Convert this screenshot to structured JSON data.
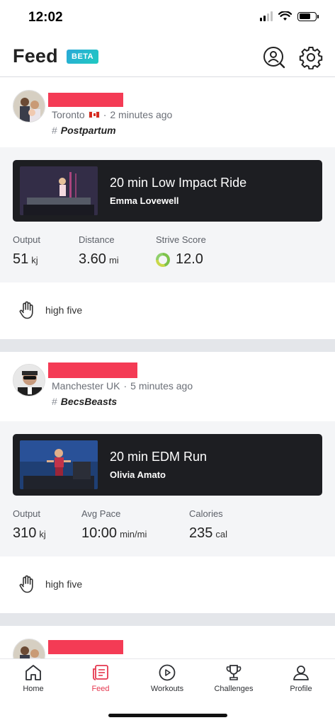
{
  "status_bar": {
    "time": "12:02"
  },
  "header": {
    "title": "Feed",
    "badge": "BETA"
  },
  "posts": [
    {
      "location": "Toronto",
      "time_ago": "2 minutes ago",
      "hashtag": "Postpartum",
      "workout": {
        "title": "20 min Low Impact Ride",
        "instructor": "Emma Lovewell"
      },
      "stats": [
        {
          "label": "Output",
          "value": "51",
          "unit": "kj"
        },
        {
          "label": "Distance",
          "value": "3.60",
          "unit": "mi"
        },
        {
          "label": "Strive Score",
          "value": "12.0",
          "unit": ""
        }
      ],
      "action_label": "high five"
    },
    {
      "location": "Manchester UK",
      "time_ago": "5 minutes ago",
      "hashtag": "BecsBeasts",
      "workout": {
        "title": "20 min EDM Run",
        "instructor": "Olivia Amato"
      },
      "stats": [
        {
          "label": "Output",
          "value": "310",
          "unit": "kj"
        },
        {
          "label": "Avg Pace",
          "value": "10:00",
          "unit": "min/mi"
        },
        {
          "label": "Calories",
          "value": "235",
          "unit": "cal"
        }
      ],
      "action_label": "high five"
    }
  ],
  "tabs": [
    {
      "label": "Home",
      "icon": "home-icon"
    },
    {
      "label": "Feed",
      "icon": "feed-icon",
      "active": true
    },
    {
      "label": "Workouts",
      "icon": "play-circle-icon"
    },
    {
      "label": "Challenges",
      "icon": "trophy-icon"
    },
    {
      "label": "Profile",
      "icon": "person-icon"
    }
  ],
  "colors": {
    "accent": "#e5384f",
    "redaction": "#f43b55",
    "card_dark": "#1d1e22",
    "beta": "#2aa9d8"
  }
}
